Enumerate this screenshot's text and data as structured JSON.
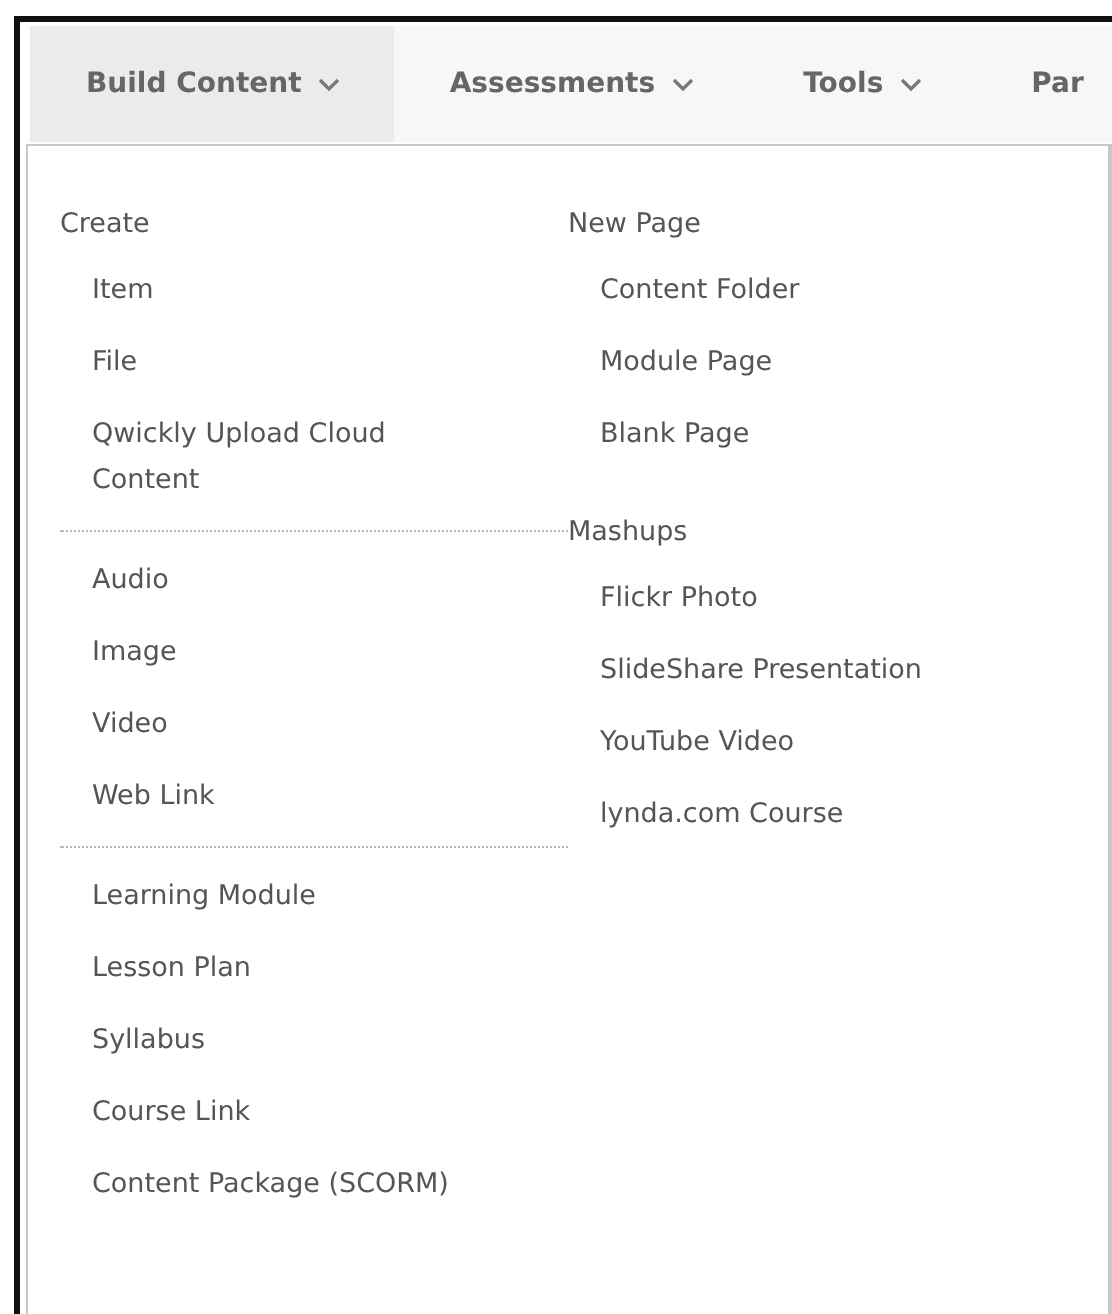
{
  "tabs": [
    {
      "label": "Build Content",
      "selected": true,
      "caret": true
    },
    {
      "label": "Assessments",
      "selected": false,
      "caret": true
    },
    {
      "label": "Tools",
      "selected": false,
      "caret": true
    },
    {
      "label": "Par",
      "selected": false,
      "caret": false
    }
  ],
  "menu": {
    "columns": [
      {
        "sections": [
          {
            "heading": "Create",
            "items": [
              "Item",
              "File",
              "Qwickly Upload Cloud Content"
            ]
          },
          {
            "items": [
              "Audio",
              "Image",
              "Video",
              "Web Link"
            ]
          },
          {
            "items": [
              "Learning Module",
              "Lesson Plan",
              "Syllabus",
              "Course Link",
              "Content Package (SCORM)"
            ]
          }
        ]
      },
      {
        "sections": [
          {
            "heading": "New Page",
            "items": [
              "Content Folder",
              "Module Page",
              "Blank Page"
            ]
          },
          {
            "heading": "Mashups",
            "items": [
              "Flickr Photo",
              "SlideShare Presentation",
              "YouTube Video",
              "lynda.com Course"
            ]
          }
        ]
      }
    ]
  }
}
